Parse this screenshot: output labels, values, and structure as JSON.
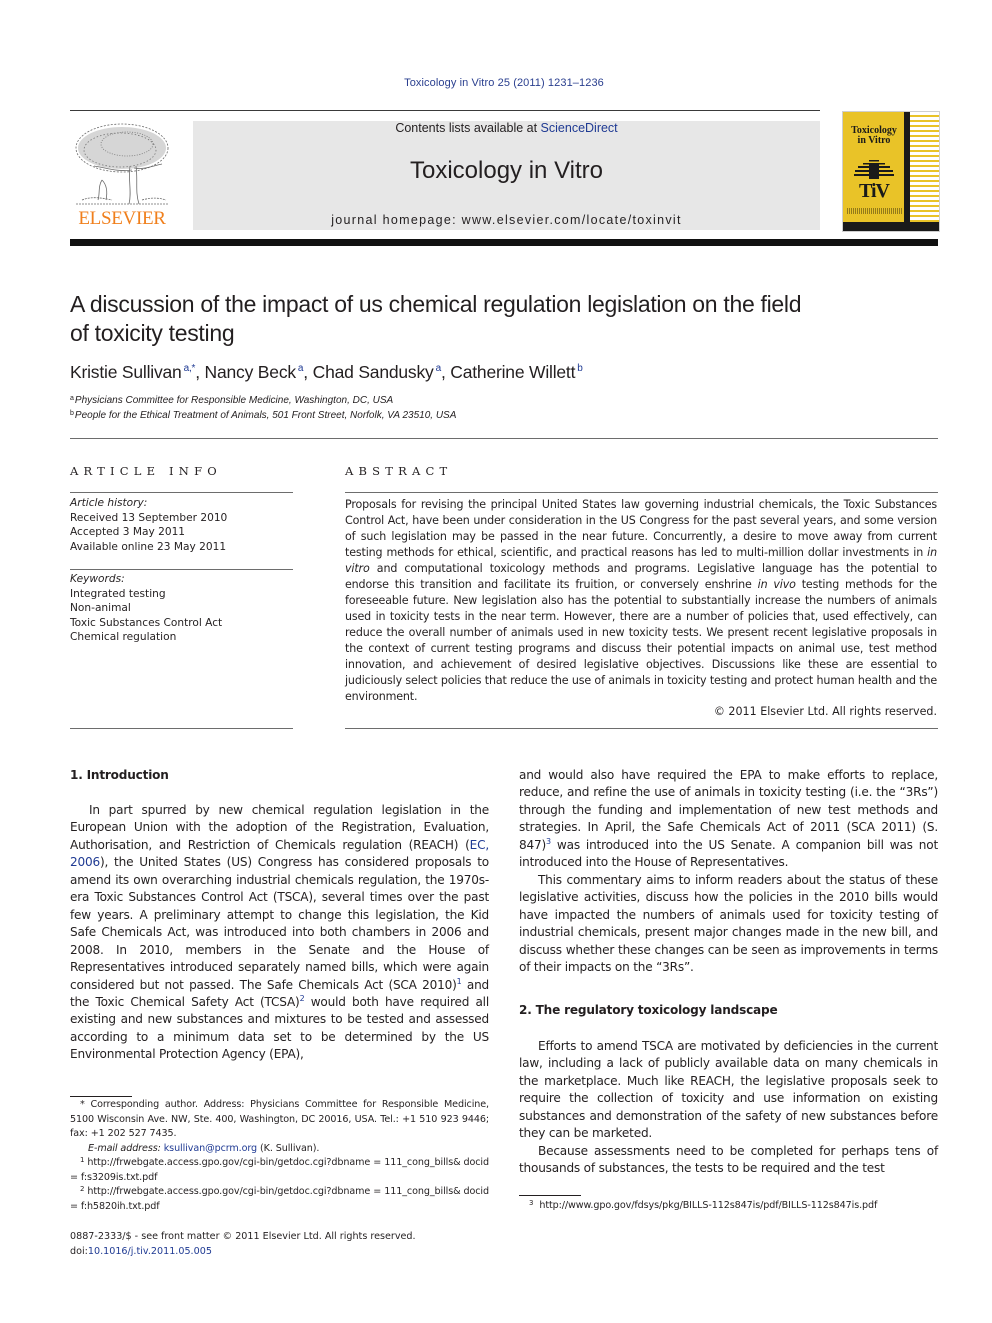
{
  "header": {
    "journal_ref": "Toxicology in Vitro 25 (2011) 1231–1236",
    "contents_prefix": "Contents lists available at ",
    "contents_link": "ScienceDirect",
    "journal_title": "Toxicology in Vitro",
    "homepage": "journal homepage: www.elsevier.com/locate/toxinvit",
    "publisher_logo_text": "ELSEVIER",
    "cover": {
      "title_line1": "Toxicology",
      "title_line2": "in Vitro",
      "mark": "TiV"
    }
  },
  "colors": {
    "link": "#1f3a93",
    "publisher_orange": "#f07f1c",
    "cover_yellow": "#e9c328",
    "banner_gray": "#e7e7e7"
  },
  "article": {
    "title_line1": "A discussion of the impact of us chemical regulation legislation on the field",
    "title_line2": "of toxicity testing",
    "authors": [
      {
        "name": "Kristie Sullivan",
        "sup": "a,*",
        "sep": ", "
      },
      {
        "name": "Nancy Beck",
        "sup": "a",
        "sep": ", "
      },
      {
        "name": "Chad Sandusky",
        "sup": "a",
        "sep": ", "
      },
      {
        "name": "Catherine Willett",
        "sup": "b",
        "sep": ""
      }
    ],
    "affiliations": [
      {
        "mark": "a",
        "text": "Physicians Committee for Responsible Medicine, Washington, DC, USA"
      },
      {
        "mark": "b",
        "text": "People for the Ethical Treatment of Animals, 501 Front Street, Norfolk, VA 23510, USA"
      }
    ]
  },
  "article_info": {
    "label": "ARTICLE INFO",
    "history_label": "Article history:",
    "history": [
      "Received 13 September 2010",
      "Accepted 3 May 2011",
      "Available online 23 May 2011"
    ],
    "keywords_label": "Keywords:",
    "keywords": [
      "Integrated testing",
      "Non-animal",
      "Toxic Substances Control Act",
      "Chemical regulation"
    ]
  },
  "abstract": {
    "label": "ABSTRACT",
    "part1": "Proposals for revising the principal United States law governing industrial chemicals, the Toxic Substances Control Act, have been under consideration in the US Congress for the past several years, and some version of such legislation may be passed in the near future. Concurrently, a desire to move away from current testing methods for ethical, scientific, and practical reasons has led to multi-million dollar investments in ",
    "italic1": "in vitro",
    "part2": " and computational toxicology methods and programs. Legislative language has the potential to endorse this transition and facilitate its fruition, or conversely enshrine ",
    "italic2": "in vivo",
    "part3": " testing methods for the foreseeable future. New legislation also has the potential to substantially increase the numbers of animals used in toxicity tests in the near term. However, there are a number of policies that, used effectively, can reduce the overall number of animals used in new toxicity tests. We present recent legislative proposals in the context of current testing programs and discuss their potential impacts on animal use, test method innovation, and achievement of desired legislative objectives. Discussions like these are essential to judiciously select policies that reduce the use of animals in toxicity testing and protect human health and the environment.",
    "copyright": "© 2011 Elsevier Ltd. All rights reserved."
  },
  "sections": {
    "intro_heading": "1. Introduction",
    "intro_p1_a": "In part spurred by new chemical regulation legislation in the European Union with the adoption of the Registration, Evaluation, Authorisation, and Restriction of Chemicals regulation (REACH) (",
    "intro_p1_link": "EC, 2006",
    "intro_p1_b": "), the United States (US) Congress has considered proposals to amend its own overarching industrial chemicals regulation, the 1970s-era Toxic Substances Control Act (TSCA), several times over the past few years. A preliminary attempt to change this legislation, the Kid Safe Chemicals Act, was introduced into both chambers in 2006 and 2008. In 2010, members in the Senate and the House of Representatives introduced separately named bills, which were again considered but not passed. The Safe Chemicals Act (SCA 2010)",
    "intro_fn1": "1",
    "intro_p1_c": " and the Toxic Chemical Safety Act (TCSA)",
    "intro_fn2": "2",
    "intro_p1_d": " would both have required all existing and new substances and mixtures to be tested and assessed according to a minimum data set to be determined by the US Environmental Protection Agency (EPA),",
    "right_p1_a": "and would also have required the EPA to make efforts to replace, reduce, and refine the use of animals in toxicity testing (i.e. the “3Rs”) through the funding and implementation of new test methods and strategies. In April, the Safe Chemicals Act of 2011 (SCA 2011) (S. 847)",
    "right_fn3": "3",
    "right_p1_b": " was introduced into the US Senate. A companion bill was not introduced into the House of Representatives.",
    "right_p2": "This commentary aims to inform readers about the status of these legislative activities, discuss how the policies in the 2010 bills would have impacted the numbers of animals used for toxicity testing of industrial chemicals, present major changes made in the new bill, and discuss whether these changes can be seen as improvements in terms of their impacts on the “3Rs”.",
    "landscape_heading": "2. The regulatory toxicology landscape",
    "landscape_p1": "Efforts to amend TSCA are motivated by deficiencies in the current law, including a lack of publicly available data on many chemicals in the marketplace. Much like REACH, the legislative proposals seek to require the collection of toxicity and use information on existing substances and demonstration of the safety of new substances before they can be marketed.",
    "landscape_p2": "Because assessments need to be completed for perhaps tens of thousands of substances, the tests to be required and the test"
  },
  "footnotes": {
    "corresponding": "* Corresponding author. Address: Physicians Committee for Responsible Medicine, 5100 Wisconsin Ave. NW, Ste. 400, Washington, DC 20016, USA. Tel.: +1 510 923 9446; fax: +1 202 527 7435.",
    "email_label": "E-mail address: ",
    "email": "ksullivan@pcrm.org",
    "email_suffix": " (K. Sullivan).",
    "fn1_mark": "1",
    "fn1": "http://frwebgate.access.gpo.gov/cgi-bin/getdoc.cgi?dbname = 111_cong_bills& docid = f:s3209is.txt.pdf",
    "fn2_mark": "2",
    "fn2": "http://frwebgate.access.gpo.gov/cgi-bin/getdoc.cgi?dbname = 111_cong_bills& docid = f:h5820ih.txt.pdf",
    "fn3_mark": "3",
    "fn3": "http://www.gpo.gov/fdsys/pkg/BILLS-112s847is/pdf/BILLS-112s847is.pdf"
  },
  "front_matter": {
    "issn_line": "0887-2333/$ - see front matter © 2011 Elsevier Ltd. All rights reserved.",
    "doi_prefix": "doi:",
    "doi": "10.1016/j.tiv.2011.05.005"
  }
}
